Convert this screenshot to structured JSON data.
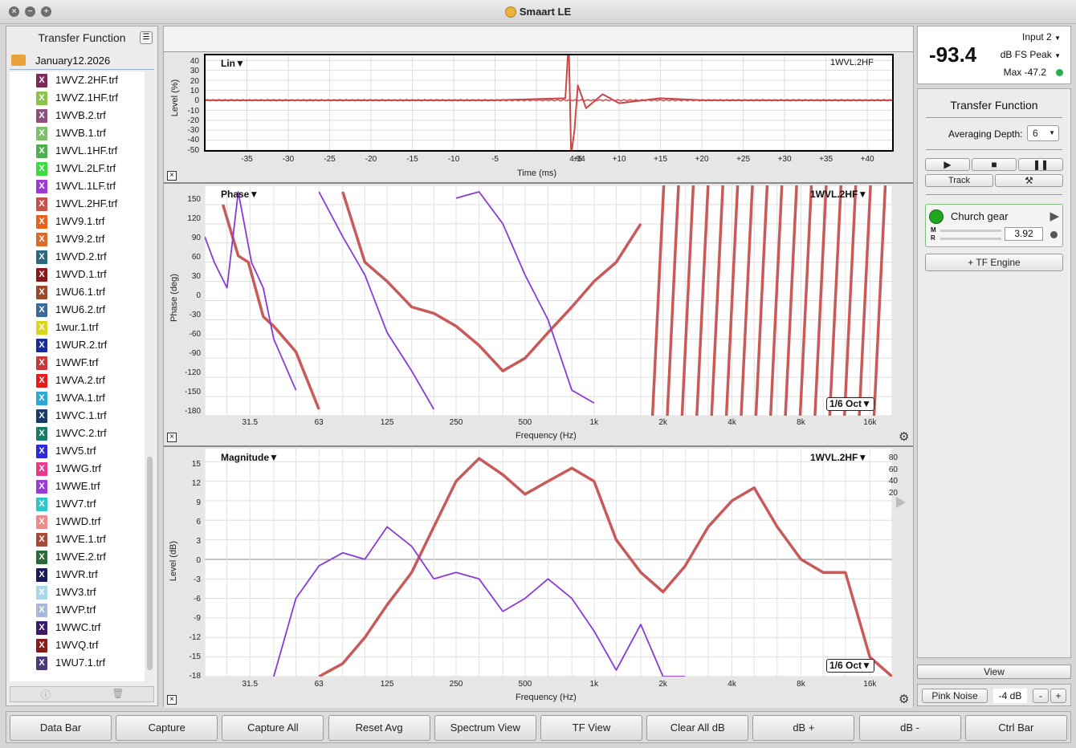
{
  "app": {
    "title": "Smaart LE"
  },
  "sidebar": {
    "title": "Transfer Function",
    "folder": "January12.2026",
    "files": [
      {
        "name": "1WVZ.2HF.trf",
        "color": "#7a2a5a"
      },
      {
        "name": "1WVZ.1HF.trf",
        "color": "#8bc34a"
      },
      {
        "name": "1WVB.2.trf",
        "color": "#8e4f7a"
      },
      {
        "name": "1WVB.1.trf",
        "color": "#7fbf6a"
      },
      {
        "name": "1WVL.1HF.trf",
        "color": "#4caf50"
      },
      {
        "name": "1WVL.2LF.trf",
        "color": "#3ddc3d"
      },
      {
        "name": "1WVL.1LF.trf",
        "color": "#9c3ad8"
      },
      {
        "name": "1WVL.2HF.trf",
        "color": "#c8504a"
      },
      {
        "name": "1WV9.1.trf",
        "color": "#e8601a"
      },
      {
        "name": "1WV9.2.trf",
        "color": "#d86a2a"
      },
      {
        "name": "1WVD.2.trf",
        "color": "#2a6a7a"
      },
      {
        "name": "1WVD.1.trf",
        "color": "#8a1a1a"
      },
      {
        "name": "1WU6.1.trf",
        "color": "#9a4a2a"
      },
      {
        "name": "1WU6.2.trf",
        "color": "#3a6a9a"
      },
      {
        "name": "1wur.1.trf",
        "color": "#d8d81a"
      },
      {
        "name": "1WUR.2.trf",
        "color": "#1a2a9a"
      },
      {
        "name": "1WWF.trf",
        "color": "#c83a3a"
      },
      {
        "name": "1WVA.2.trf",
        "color": "#e81a1a"
      },
      {
        "name": "1WVA.1.trf",
        "color": "#2aa8d8"
      },
      {
        "name": "1WVC.1.trf",
        "color": "#1a3a6a"
      },
      {
        "name": "1WVC.2.trf",
        "color": "#1a7a6a"
      },
      {
        "name": "1WV5.trf",
        "color": "#2a2ad8"
      },
      {
        "name": "1WWG.trf",
        "color": "#e83a8a"
      },
      {
        "name": "1WWE.trf",
        "color": "#9a3ad8"
      },
      {
        "name": "1WV7.trf",
        "color": "#2ac8c8"
      },
      {
        "name": "1WWD.trf",
        "color": "#f08a8a"
      },
      {
        "name": "1WVE.1.trf",
        "color": "#a84a3a"
      },
      {
        "name": "1WVE.2.trf",
        "color": "#2a6a3a"
      },
      {
        "name": "1WVR.trf",
        "color": "#1a1a5a"
      },
      {
        "name": "1WV3.trf",
        "color": "#a8d8e8"
      },
      {
        "name": "1WVP.trf",
        "color": "#a8b8d8"
      },
      {
        "name": "1WWC.trf",
        "color": "#3a1a6a"
      },
      {
        "name": "1WVQ.trf",
        "color": "#8a1a1a"
      },
      {
        "name": "1WU7.1.trf",
        "color": "#4a3a7a"
      }
    ]
  },
  "impulse": {
    "title": "Lin",
    "trace": "1WVL.2HF",
    "ylabel": "Level (%)",
    "xlabel": "Time (ms)",
    "yticks": [
      "40",
      "30",
      "20",
      "10",
      "0",
      "-10",
      "-20",
      "-30",
      "-40",
      "-50"
    ],
    "xticks": [
      "-35",
      "-30",
      "-25",
      "-20",
      "-15",
      "-10",
      "-5",
      "4.94",
      "+5",
      "+10",
      "+15",
      "+20",
      "+25",
      "+30",
      "+35",
      "+40"
    ]
  },
  "phase": {
    "title": "Phase",
    "trace": "1WVL.2HF",
    "ylabel": "Phase (deg)",
    "xlabel": "Frequency (Hz)",
    "yticks": [
      "150",
      "120",
      "90",
      "60",
      "30",
      "0",
      "-30",
      "-60",
      "-90",
      "-120",
      "-150",
      "-180"
    ],
    "xticks": [
      "31.5",
      "63",
      "125",
      "250",
      "500",
      "1k",
      "2k",
      "4k",
      "8k",
      "16k"
    ],
    "oct": "1/6 Oct"
  },
  "magnitude": {
    "title": "Magnitude",
    "trace": "1WVL.2HF",
    "ylabel": "Level (dB)",
    "xlabel": "Frequency (Hz)",
    "yticks": [
      "15",
      "12",
      "9",
      "6",
      "3",
      "0",
      "-3",
      "-6",
      "-9",
      "-12",
      "-15",
      "-18"
    ],
    "xticks": [
      "31.5",
      "63",
      "125",
      "250",
      "500",
      "1k",
      "2k",
      "4k",
      "8k",
      "16k"
    ],
    "coh_ticks": [
      "80",
      "60",
      "40",
      "20"
    ],
    "oct": "1/6 Oct"
  },
  "meter": {
    "input": "Input 2",
    "value": "-93.4",
    "mode": "dB FS Peak",
    "max": "Max -47.2"
  },
  "tf_panel": {
    "title": "Transfer Function",
    "avg_label": "Averaging Depth:",
    "avg_value": "6",
    "track_label": "Track",
    "measurement": "Church gear",
    "m_label": "M",
    "r_label": "R",
    "delay_value": "3.92",
    "add_engine": "+ TF Engine",
    "view_label": "View",
    "pink_noise": "Pink Noise",
    "pink_level": "-4 dB",
    "minus": "-",
    "plus": "+"
  },
  "bottom_bar": [
    "Data Bar",
    "Capture",
    "Capture All",
    "Reset Avg",
    "Spectrum View",
    "TF View",
    "Clear All dB",
    "dB +",
    "dB -",
    "Ctrl Bar"
  ],
  "chart_data": [
    {
      "type": "line",
      "title": "Lin",
      "xlabel": "Time (ms)",
      "ylabel": "Level (%)",
      "xlim": [
        -40,
        43
      ],
      "ylim": [
        -50,
        45
      ],
      "series": [
        {
          "name": "1WVL.2HF",
          "x": [
            -40,
            -20,
            -5,
            3.5,
            3.9,
            4.2,
            4.6,
            5,
            6,
            8,
            10,
            15,
            20,
            30,
            43
          ],
          "y": [
            0,
            0,
            0,
            2,
            60,
            -55,
            -30,
            15,
            -8,
            6,
            -3,
            2,
            0,
            0,
            0
          ]
        }
      ]
    },
    {
      "type": "line",
      "title": "Phase",
      "xlabel": "Frequency (Hz)",
      "ylabel": "Phase (deg)",
      "xscale": "log",
      "xlim": [
        20,
        20000
      ],
      "ylim": [
        -180,
        180
      ],
      "series": [
        {
          "name": "1WVL.2HF",
          "x": [
            24,
            28,
            31,
            36,
            40,
            50,
            63,
            80,
            100,
            125,
            160,
            200,
            250,
            315,
            400,
            500,
            630,
            800,
            1000,
            1250,
            1600
          ],
          "y": [
            150,
            70,
            60,
            -25,
            -40,
            -80,
            -170,
            170,
            60,
            30,
            -10,
            -20,
            -40,
            -70,
            -110,
            -90,
            -50,
            -10,
            30,
            60,
            120
          ]
        },
        {
          "name": "purple",
          "x": [
            20,
            22,
            25,
            28,
            32,
            36,
            40,
            50,
            63,
            80,
            100,
            125,
            160,
            200,
            250,
            315,
            400,
            500,
            630,
            800,
            1000
          ],
          "y": [
            100,
            60,
            20,
            170,
            60,
            20,
            -60,
            -140,
            170,
            100,
            40,
            -50,
            -110,
            -170,
            160,
            170,
            120,
            40,
            -30,
            -140,
            -160
          ]
        }
      ]
    },
    {
      "type": "line",
      "title": "Magnitude",
      "xlabel": "Frequency (Hz)",
      "ylabel": "Level (dB)",
      "xscale": "log",
      "xlim": [
        20,
        20000
      ],
      "ylim": [
        -18,
        17
      ],
      "series": [
        {
          "name": "1WVL.2HF",
          "x": [
            63,
            80,
            100,
            125,
            160,
            200,
            250,
            315,
            400,
            500,
            630,
            800,
            1000,
            1250,
            1600,
            2000,
            2500,
            3150,
            4000,
            5000,
            6300,
            8000,
            10000,
            12500,
            16000,
            20000
          ],
          "y": [
            -18,
            -16,
            -12,
            -7,
            -2,
            5,
            12,
            15.5,
            13,
            10,
            12,
            14,
            12,
            3,
            -2,
            -5,
            -1,
            5,
            9,
            11,
            5,
            0,
            -2,
            -2,
            -15,
            -18
          ]
        },
        {
          "name": "purple",
          "x": [
            40,
            50,
            63,
            80,
            100,
            125,
            160,
            200,
            250,
            315,
            400,
            500,
            630,
            800,
            1000,
            1250,
            1600,
            2000,
            2500
          ],
          "y": [
            -18,
            -6,
            -1,
            1,
            0,
            5,
            2,
            -3,
            -2,
            -3,
            -8,
            -6,
            -3,
            -6,
            -11,
            -17,
            -10,
            -18,
            -18
          ]
        }
      ]
    }
  ]
}
